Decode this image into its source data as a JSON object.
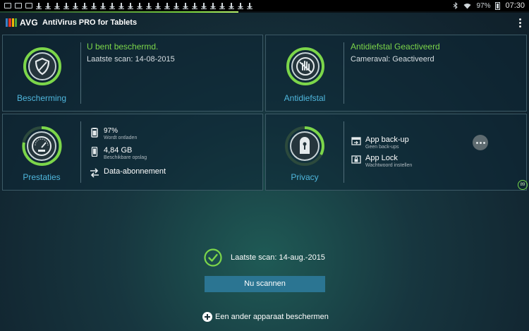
{
  "status_bar": {
    "battery": "97%",
    "time": "07:30"
  },
  "app": {
    "logo": "AVG",
    "title": "AntiVirus PRO for Tablets",
    "logo_colors": [
      "#3a80c8",
      "#e0362b",
      "#f2b705",
      "#4ba33c"
    ]
  },
  "cards": {
    "protection": {
      "label": "Bescherming",
      "status_title": "U bent beschermd.",
      "status_sub": "Laatste scan: 14-08-2015",
      "icon": "shield-icon"
    },
    "antitheft": {
      "label": "Antidiefstal",
      "status_title": "Antidiefstal Geactiveerd",
      "status_sub": "Cameraval: Geactiveerd",
      "icon": "stop-hand-icon"
    },
    "performance": {
      "label": "Prestaties",
      "icon": "speedometer-icon",
      "battery_value": "97%",
      "battery_sub": "Wordt ontladen",
      "storage_value": "4,84 GB",
      "storage_sub": "Beschikbare opslag",
      "data_label": "Data-abonnement"
    },
    "privacy": {
      "label": "Privacy",
      "icon": "lock-icon",
      "backup_label": "App back-up",
      "backup_sub": "Geen back-ups",
      "applock_label": "App Lock",
      "applock_sub": "Wachtwoord instellen",
      "badge": "89"
    }
  },
  "bottom": {
    "last_scan": "Laatste scan: 14-aug.-2015",
    "scan_button": "Nu scannen",
    "protect_other": "Een ander apparaat beschermen"
  },
  "colors": {
    "accent_green": "#7cd64a",
    "accent_blue": "#4fb7dd",
    "button_blue": "#2b7592"
  }
}
